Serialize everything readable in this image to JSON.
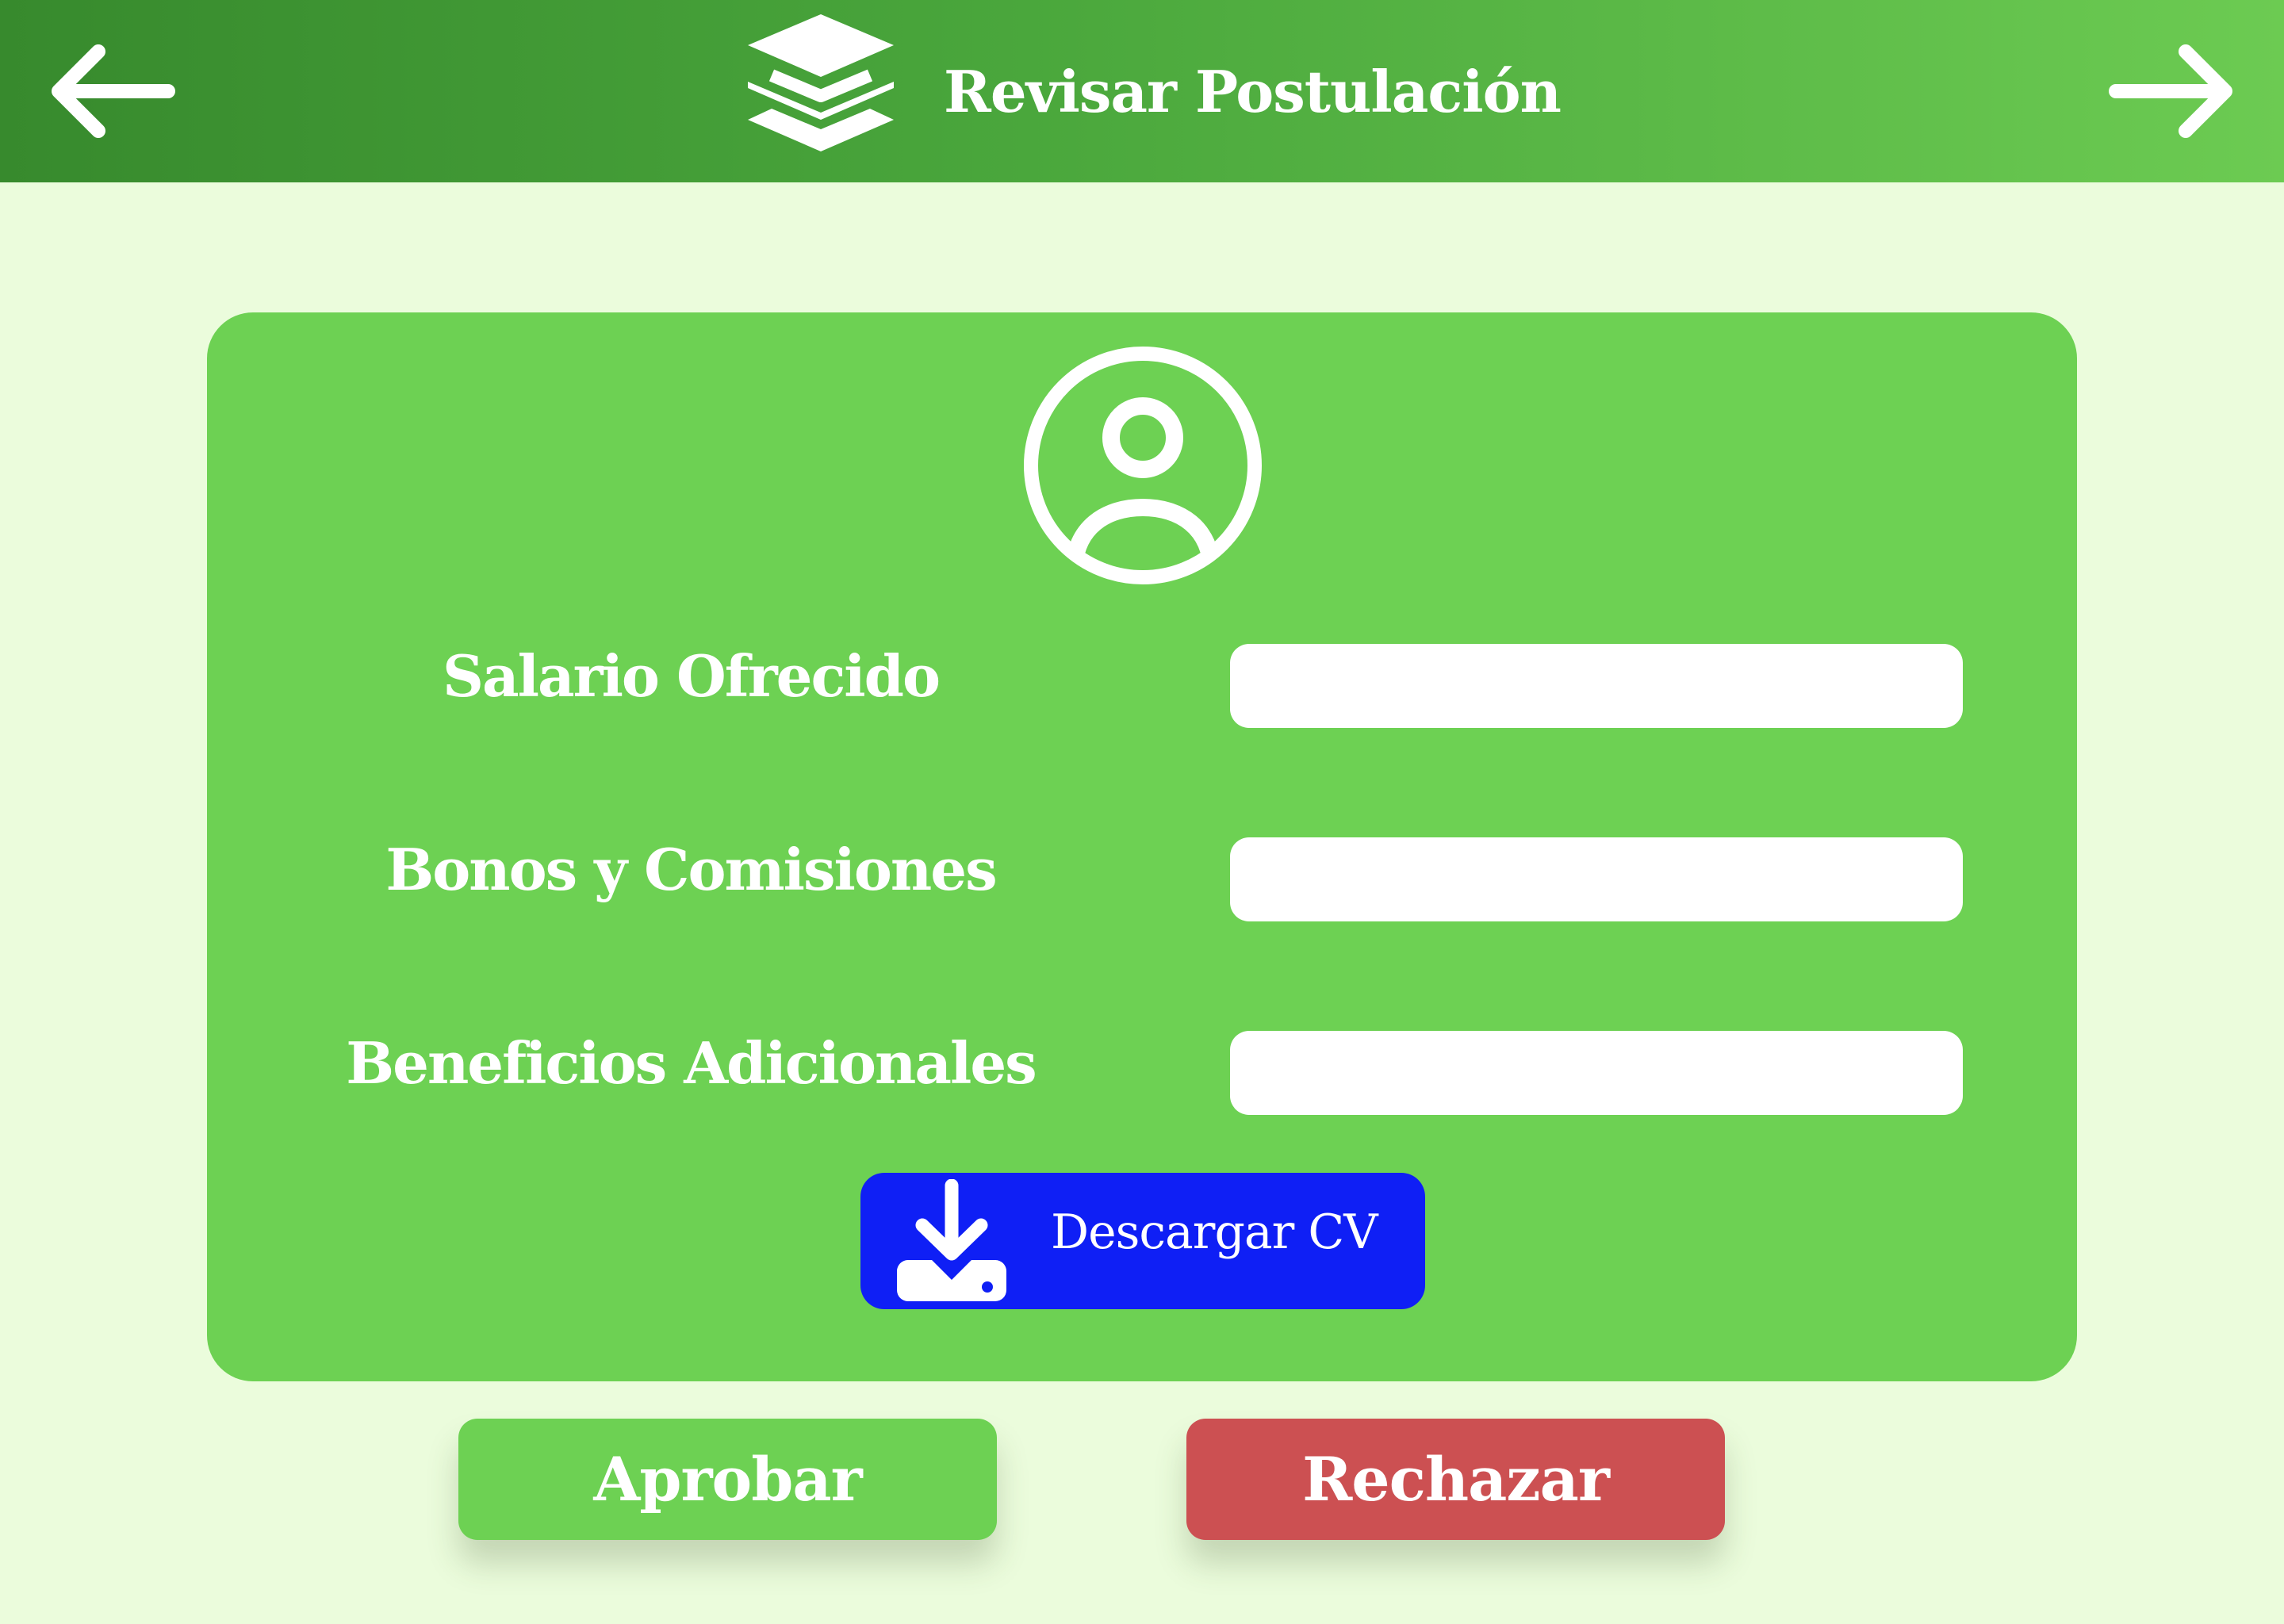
{
  "header": {
    "title": "Revisar Postulación",
    "back_icon": "arrow-left-icon",
    "forward_icon": "arrow-right-icon",
    "title_icon": "layers-icon"
  },
  "card": {
    "avatar_icon": "user-circle-icon",
    "fields": [
      {
        "label": "Salario Ofrecido",
        "value": "",
        "placeholder": ""
      },
      {
        "label": "Bonos y Comisiones",
        "value": "",
        "placeholder": ""
      },
      {
        "label": "Beneficios Adicionales",
        "value": "",
        "placeholder": ""
      }
    ],
    "download": {
      "label": "Descargar CV",
      "icon": "download-tray-icon"
    }
  },
  "actions": {
    "approve_label": "Aprobar",
    "reject_label": "Rechazar"
  },
  "colors": {
    "background": "#ebfcdc",
    "header_start": "#378a2d",
    "header_end": "#6ccb52",
    "card": "#6dd153",
    "download_button": "#0f1ff5",
    "approve_button": "#6dd153",
    "reject_button": "#cc5052",
    "text": "#ffffff"
  }
}
